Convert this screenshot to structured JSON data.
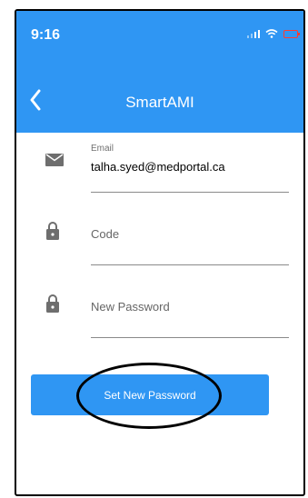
{
  "status_bar": {
    "time": "9:16"
  },
  "header": {
    "title": "SmartAMI",
    "back_icon": "chevron-left-icon"
  },
  "form": {
    "email": {
      "label": "Email",
      "value": "talha.syed@medportal.ca",
      "icon": "mail-icon"
    },
    "code": {
      "placeholder": "Code",
      "icon": "lock-icon"
    },
    "new_password": {
      "placeholder": "New Password",
      "icon": "lock-icon"
    }
  },
  "submit": {
    "label": "Set New Password"
  },
  "colors": {
    "primary": "#2f96f3",
    "battery_low": "#ff3b30"
  }
}
